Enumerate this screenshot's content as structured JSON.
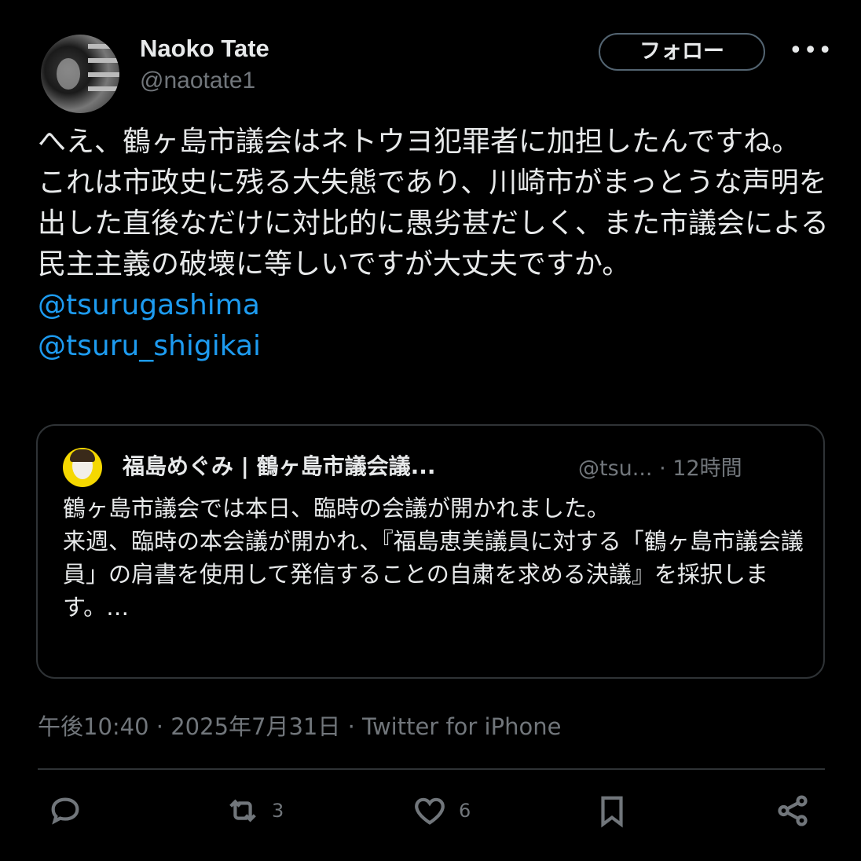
{
  "author": {
    "name": "Naoko Tate",
    "handle": "@naotate1",
    "follow_label": "フォロー",
    "more_label": "•••"
  },
  "tweet": {
    "line1": "へえ、鶴ヶ島市議会はネトウヨ犯罪者に加担したんですね。",
    "line2": "これは市政史に残る大失態であり、川崎市がまっとうな声明を出した直後なだけに対比的に愚劣甚だしく、また市議会による民主主義の破壊に等しいですが大丈夫ですか。",
    "mention1": "@tsurugashima",
    "mention2": "@tsuru_shigikai"
  },
  "quoted": {
    "name": "福島めぐみ | 鶴ヶ島市議会議...",
    "handle_time": "@tsu... · 12時間",
    "para1": "鶴ヶ島市議会では本日、臨時の会議が開かれました。",
    "para2": "来週、臨時の本会議が開かれ、『福島恵美議員に対する「鶴ヶ島市議会議員」の肩書を使用して発信することの自粛を求める決議』を採択します。…"
  },
  "meta": "午後10:40 · 2025年7月31日 · Twitter for iPhone",
  "actions": {
    "retweets": "3",
    "likes": "6"
  }
}
